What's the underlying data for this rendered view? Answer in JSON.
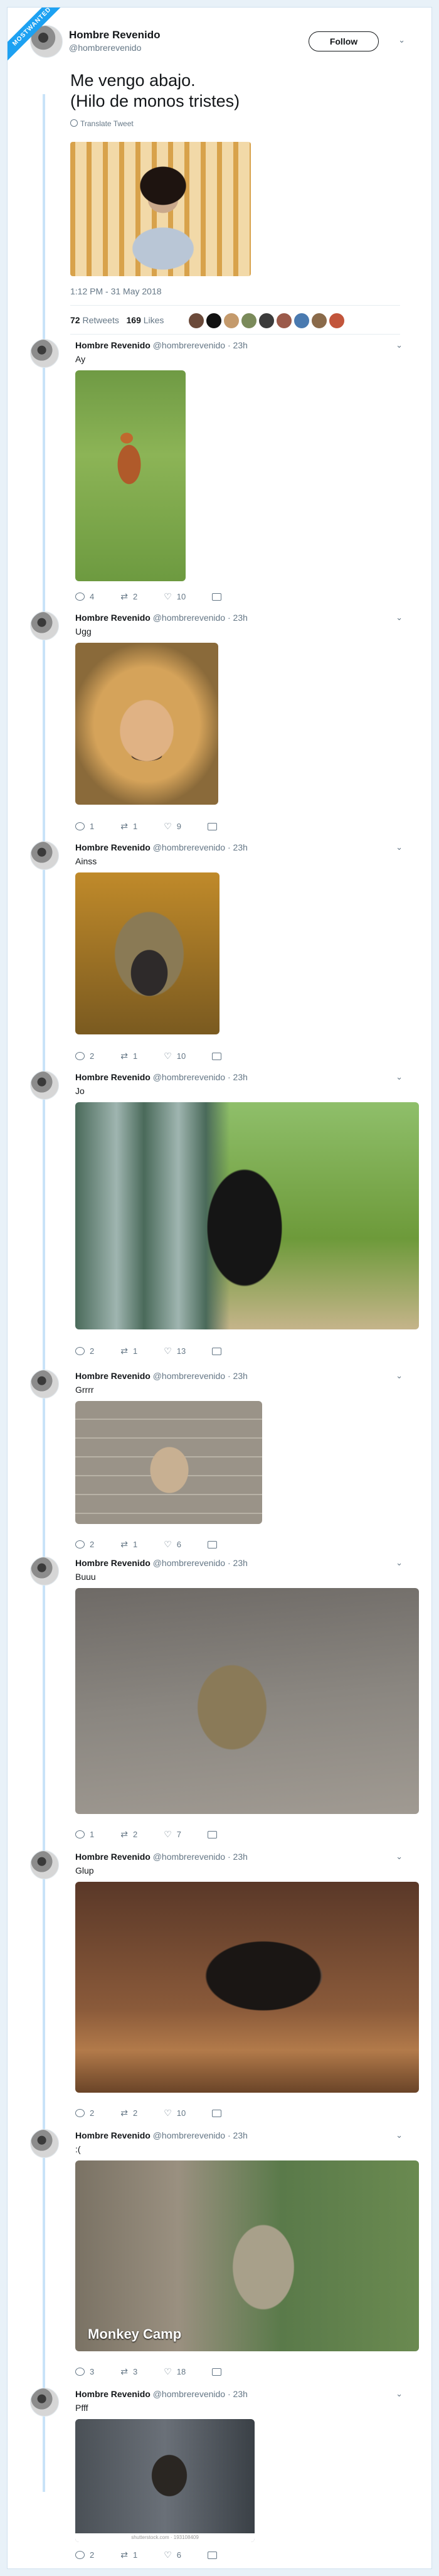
{
  "badge": "MOSTWANTED",
  "main": {
    "name": "Hombre Revenido",
    "handle": "@hombrerevenido",
    "follow_label": "Follow",
    "text_line1": "Me vengo abajo.",
    "text_line2": "(Hilo de monos tristes)",
    "translate": "Translate Tweet",
    "time": "1:12 PM - 31 May 2018",
    "retweets": "72",
    "retweets_label": "Retweets",
    "likes": "169",
    "likes_label": "Likes"
  },
  "replies": [
    {
      "name": "Hombre Revenido",
      "handle": "@hombrerevenido",
      "time": "23h",
      "text": "Ay",
      "reply": "4",
      "rt": "2",
      "like": "10"
    },
    {
      "name": "Hombre Revenido",
      "handle": "@hombrerevenido",
      "time": "23h",
      "text": "Ugg",
      "reply": "1",
      "rt": "1",
      "like": "9"
    },
    {
      "name": "Hombre Revenido",
      "handle": "@hombrerevenido",
      "time": "23h",
      "text": "Ainss",
      "reply": "2",
      "rt": "1",
      "like": "10"
    },
    {
      "name": "Hombre Revenido",
      "handle": "@hombrerevenido",
      "time": "23h",
      "text": "Jo",
      "reply": "2",
      "rt": "1",
      "like": "13"
    },
    {
      "name": "Hombre Revenido",
      "handle": "@hombrerevenido",
      "time": "23h",
      "text": "Grrrr",
      "reply": "2",
      "rt": "1",
      "like": "6"
    },
    {
      "name": "Hombre Revenido",
      "handle": "@hombrerevenido",
      "time": "23h",
      "text": "Buuu",
      "reply": "1",
      "rt": "2",
      "like": "7"
    },
    {
      "name": "Hombre Revenido",
      "handle": "@hombrerevenido",
      "time": "23h",
      "text": "Glup",
      "reply": "2",
      "rt": "2",
      "like": "10"
    },
    {
      "name": "Hombre Revenido",
      "handle": "@hombrerevenido",
      "time": "23h",
      "text": ":(",
      "reply": "3",
      "rt": "3",
      "like": "18",
      "watermark": "Monkey Camp"
    },
    {
      "name": "Hombre Revenido",
      "handle": "@hombrerevenido",
      "time": "23h",
      "text": "Pfff",
      "reply": "2",
      "rt": "1",
      "like": "6",
      "credit": "shutterstock.com · 193108409"
    }
  ],
  "icons": [
    "chevron-down-icon",
    "globe-icon",
    "reply-icon",
    "retweet-icon",
    "like-icon",
    "dm-icon"
  ],
  "colors": {
    "accent": "#1da1f2",
    "background": "#e8f1f8",
    "muted": "#657786",
    "thread": "#c9e3f8"
  }
}
